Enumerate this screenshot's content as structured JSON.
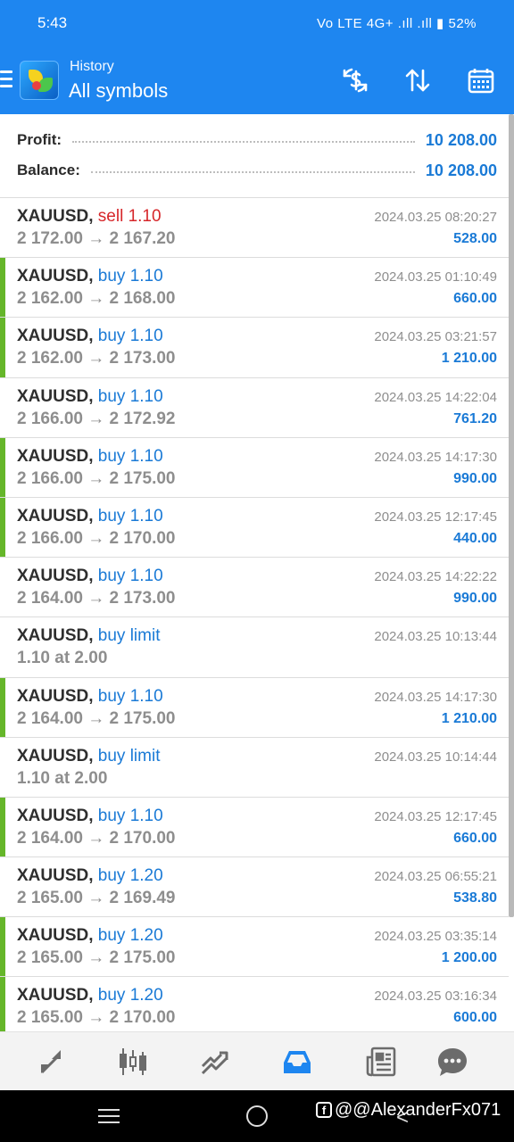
{
  "status_bar": {
    "time": "5:43",
    "indicators": "Vo LTE 4G+ .ıll .ıll ▮ 52%"
  },
  "app_bar": {
    "title": "History",
    "subtitle": "All symbols",
    "actions": [
      "dollar-exchange-icon",
      "sort-icon",
      "calendar-icon"
    ]
  },
  "summary": {
    "profit_label": "Profit:",
    "profit_value": "10 208.00",
    "balance_label": "Balance:",
    "balance_value": "10 208.00"
  },
  "deals": [
    {
      "symbol": "XAUUSD,",
      "type": "sell 1.10",
      "direction": "sell",
      "prices": "2 172.00 → 2 167.20",
      "time": "2024.03.25 08:20:27",
      "profit": "528.00",
      "accent": false
    },
    {
      "symbol": "XAUUSD,",
      "type": "buy 1.10",
      "direction": "buy",
      "prices": "2 162.00 → 2 168.00",
      "time": "2024.03.25 01:10:49",
      "profit": "660.00",
      "accent": true
    },
    {
      "symbol": "XAUUSD,",
      "type": "buy 1.10",
      "direction": "buy",
      "prices": "2 162.00 → 2 173.00",
      "time": "2024.03.25 03:21:57",
      "profit": "1 210.00",
      "accent": true
    },
    {
      "symbol": "XAUUSD,",
      "type": "buy 1.10",
      "direction": "buy",
      "prices": "2 166.00 → 2 172.92",
      "time": "2024.03.25 14:22:04",
      "profit": "761.20",
      "accent": false
    },
    {
      "symbol": "XAUUSD,",
      "type": "buy 1.10",
      "direction": "buy",
      "prices": "2 166.00 → 2 175.00",
      "time": "2024.03.25 14:17:30",
      "profit": "990.00",
      "accent": true
    },
    {
      "symbol": "XAUUSD,",
      "type": "buy 1.10",
      "direction": "buy",
      "prices": "2 166.00 → 2 170.00",
      "time": "2024.03.25 12:17:45",
      "profit": "440.00",
      "accent": true
    },
    {
      "symbol": "XAUUSD,",
      "type": "buy 1.10",
      "direction": "buy",
      "prices": "2 164.00 → 2 173.00",
      "time": "2024.03.25 14:22:22",
      "profit": "990.00",
      "accent": false
    },
    {
      "symbol": "XAUUSD,",
      "type": "buy limit",
      "direction": "buy",
      "prices": "1.10 at 2.00",
      "time": "2024.03.25 10:13:44",
      "profit": "",
      "accent": false
    },
    {
      "symbol": "XAUUSD,",
      "type": "buy 1.10",
      "direction": "buy",
      "prices": "2 164.00 → 2 175.00",
      "time": "2024.03.25 14:17:30",
      "profit": "1 210.00",
      "accent": true
    },
    {
      "symbol": "XAUUSD,",
      "type": "buy limit",
      "direction": "buy",
      "prices": "1.10 at 2.00",
      "time": "2024.03.25 10:14:44",
      "profit": "",
      "accent": false
    },
    {
      "symbol": "XAUUSD,",
      "type": "buy 1.10",
      "direction": "buy",
      "prices": "2 164.00 → 2 170.00",
      "time": "2024.03.25 12:17:45",
      "profit": "660.00",
      "accent": true
    },
    {
      "symbol": "XAUUSD,",
      "type": "buy 1.20",
      "direction": "buy",
      "prices": "2 165.00 → 2 169.49",
      "time": "2024.03.25 06:55:21",
      "profit": "538.80",
      "accent": false
    },
    {
      "symbol": "XAUUSD,",
      "type": "buy 1.20",
      "direction": "buy",
      "prices": "2 165.00 → 2 175.00",
      "time": "2024.03.25 03:35:14",
      "profit": "1 200.00",
      "accent": true
    },
    {
      "symbol": "XAUUSD,",
      "type": "buy 1.20",
      "direction": "buy",
      "prices": "2 165.00 → 2 170.00",
      "time": "2024.03.25 03:16:34",
      "profit": "600.00",
      "accent": true
    }
  ],
  "bottom_nav": [
    "quotes-icon",
    "chart-icon",
    "trade-icon",
    "history-icon",
    "news-icon",
    "chat-icon"
  ],
  "bottom_nav_active": "history-icon",
  "watermark": "@@AlexanderFx071",
  "colors": {
    "primary": "#1e86f0",
    "buy": "#1a7ad6",
    "sell": "#d6262a",
    "accent": "#65b62a"
  }
}
